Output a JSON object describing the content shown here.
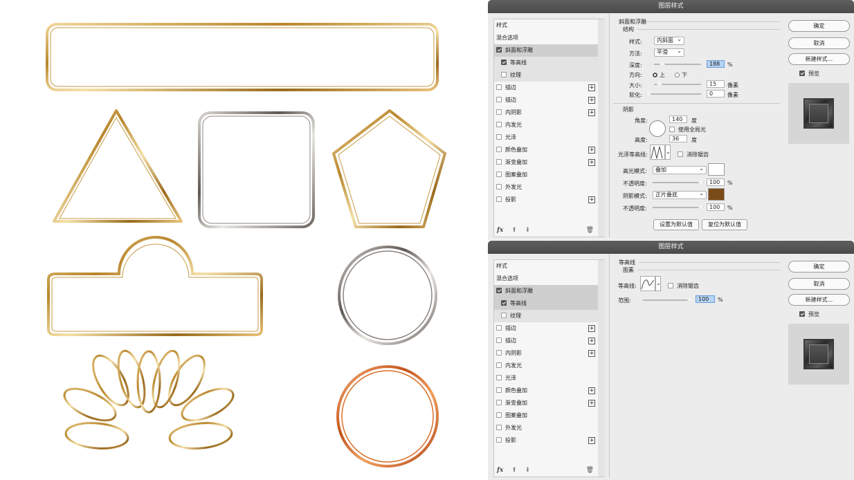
{
  "colors": {
    "gold": "#c9962f",
    "silver": "#8a8580",
    "copper": "#d9702a",
    "highlight_swatch": "#ffffff",
    "shadow_swatch": "#7a4b16"
  },
  "canvas": {
    "shapes": [
      "rounded-rectangle-frame",
      "triangle-frame",
      "rounded-square-frame",
      "pentagon-frame",
      "tab-label-frame",
      "silver-ring",
      "lotus-ornament",
      "copper-ring"
    ]
  },
  "dialog1": {
    "title": "图层样式",
    "layers": [
      {
        "label": "样式",
        "checkbox": null,
        "plus": false,
        "sel": false,
        "sub": false
      },
      {
        "label": "混合选项",
        "checkbox": null,
        "plus": false,
        "sel": false,
        "sub": false
      },
      {
        "label": "斜面和浮雕",
        "checkbox": true,
        "plus": false,
        "sel": true,
        "sub": false
      },
      {
        "label": "等高线",
        "checkbox": true,
        "plus": false,
        "sel": false,
        "sub": true
      },
      {
        "label": "纹理",
        "checkbox": false,
        "plus": false,
        "sel": false,
        "sub": true
      },
      {
        "label": "描边",
        "checkbox": false,
        "plus": true,
        "sel": false,
        "sub": false
      },
      {
        "label": "描边",
        "checkbox": false,
        "plus": true,
        "sel": false,
        "sub": false
      },
      {
        "label": "内阴影",
        "checkbox": false,
        "plus": true,
        "sel": false,
        "sub": false
      },
      {
        "label": "内发光",
        "checkbox": false,
        "plus": false,
        "sel": false,
        "sub": false
      },
      {
        "label": "光泽",
        "checkbox": false,
        "plus": false,
        "sel": false,
        "sub": false
      },
      {
        "label": "颜色叠加",
        "checkbox": false,
        "plus": true,
        "sel": false,
        "sub": false
      },
      {
        "label": "渐变叠加",
        "checkbox": false,
        "plus": true,
        "sel": false,
        "sub": false
      },
      {
        "label": "图案叠加",
        "checkbox": false,
        "plus": false,
        "sel": false,
        "sub": false
      },
      {
        "label": "外发光",
        "checkbox": false,
        "plus": false,
        "sel": false,
        "sub": false
      },
      {
        "label": "投影",
        "checkbox": false,
        "plus": true,
        "sel": false,
        "sub": false
      }
    ],
    "fx": "fx",
    "section_title": "斜面和浮雕",
    "structure": {
      "title": "结构",
      "style_label": "样式:",
      "style_value": "内斜面",
      "technique_label": "方法:",
      "technique_value": "平滑",
      "depth_label": "深度:",
      "depth_value": "188",
      "depth_unit": "%",
      "direction_label": "方向:",
      "direction_up": "上",
      "direction_down": "下",
      "size_label": "大小:",
      "size_value": "15",
      "size_unit": "像素",
      "soften_label": "软化:",
      "soften_value": "0",
      "soften_unit": "像素"
    },
    "shading": {
      "title": "阴影",
      "angle_label": "角度:",
      "angle_value": "140",
      "angle_unit": "度",
      "global_light": "使用全局光",
      "altitude_label": "高度:",
      "altitude_value": "36",
      "altitude_unit": "度",
      "gloss_contour_label": "光泽等高线:",
      "antialias": "消除锯齿",
      "highlight_mode_label": "高光模式:",
      "highlight_mode_value": "叠加",
      "highlight_opacity_label": "不透明度:",
      "highlight_opacity_value": "100",
      "highlight_opacity_unit": "%",
      "shadow_mode_label": "阴影模式:",
      "shadow_mode_value": "正片叠底",
      "shadow_opacity_label": "不透明度:",
      "shadow_opacity_value": "100",
      "shadow_opacity_unit": "%"
    },
    "make_default": "设置为默认值",
    "reset_default": "复位为默认值",
    "ok": "确定",
    "cancel": "取消",
    "new_style": "新建样式...",
    "preview": "预览"
  },
  "dialog2": {
    "title": "图层样式",
    "section_title": "等高线",
    "elements_title": "图素",
    "contour_label": "等高线:",
    "antialias": "消除锯齿",
    "range_label": "范围:",
    "range_value": "100",
    "range_unit": "%",
    "ok": "确定",
    "cancel": "取消",
    "new_style": "新建样式...",
    "preview": "预览"
  }
}
